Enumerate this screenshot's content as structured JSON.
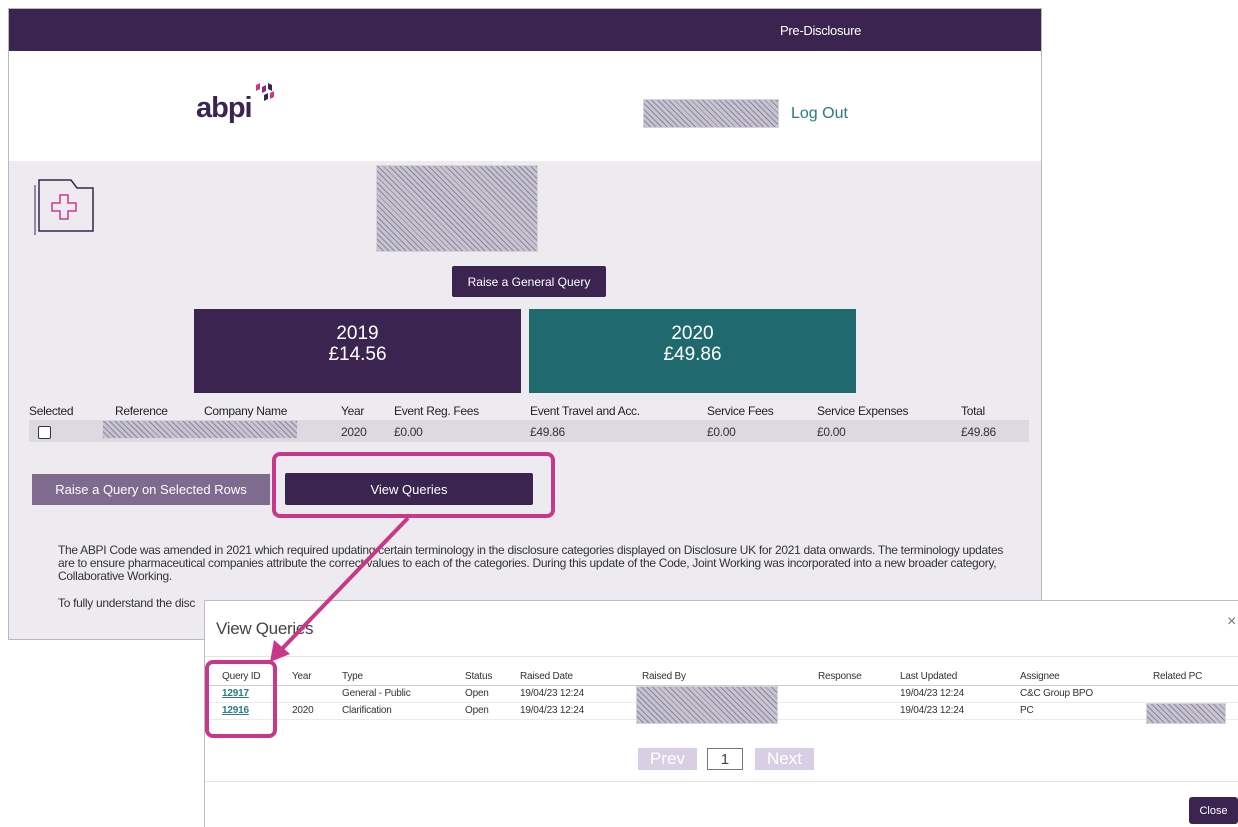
{
  "topbar": {
    "nav_label": "Pre-Disclosure"
  },
  "header": {
    "logo_text": "abpi",
    "logout_label": "Log Out"
  },
  "actions": {
    "raise_general_query": "Raise a General Query",
    "raise_selected_rows": "Raise a Query on Selected Rows",
    "view_queries": "View Queries"
  },
  "summary_cards": [
    {
      "year": "2019",
      "amount": "£14.56",
      "color": "#3b2550"
    },
    {
      "year": "2020",
      "amount": "£49.86",
      "color": "#206a6f"
    }
  ],
  "disclosure_table": {
    "headers": [
      "Selected",
      "Reference",
      "Company Name",
      "Year",
      "Event Reg. Fees",
      "Event Travel and Acc.",
      "Service Fees",
      "Service Expenses",
      "Total"
    ],
    "rows": [
      {
        "year": "2020",
        "event_reg_fees": "£0.00",
        "event_travel": "£49.86",
        "service_fees": "£0.00",
        "service_expenses": "£0.00",
        "total": "£49.86"
      }
    ]
  },
  "disclaimer": {
    "para1": "The ABPI Code was amended in 2021 which required updating certain terminology in the disclosure categories displayed on Disclosure UK for 2021 data onwards. The terminology updates are to ensure pharmaceutical companies attribute the correct values to each of the categories. During this update of the Code, Joint Working was incorporated into a new broader category, Collaborative Working.",
    "para2": "To fully understand the disc"
  },
  "modal": {
    "title": "View Queries",
    "close_x": "×",
    "headers": [
      "Query ID",
      "Year",
      "Type",
      "Status",
      "Raised Date",
      "Raised By",
      "Response",
      "Last Updated",
      "Assignee",
      "Related PC"
    ],
    "rows": [
      {
        "query_id": "12917",
        "year": "",
        "type": "General - Public",
        "status": "Open",
        "raised_date": "19/04/23 12:24",
        "last_updated": "19/04/23 12:24",
        "assignee": "C&C Group BPO"
      },
      {
        "query_id": "12916",
        "year": "2020",
        "type": "Clarification",
        "status": "Open",
        "raised_date": "19/04/23 12:24",
        "last_updated": "19/04/23 12:24",
        "assignee": "PC"
      }
    ],
    "pager": {
      "prev": "Prev",
      "page": "1",
      "next": "Next"
    },
    "close_button": "Close"
  },
  "colors": {
    "brand_purple": "#3b2550",
    "teal": "#206a6f",
    "highlight_pink": "#c8388a",
    "link_teal": "#2c7b80"
  },
  "icons": [
    "logo-mark-icon",
    "folder-medical-icon",
    "checkbox-icon",
    "close-icon",
    "annotation-arrow"
  ]
}
